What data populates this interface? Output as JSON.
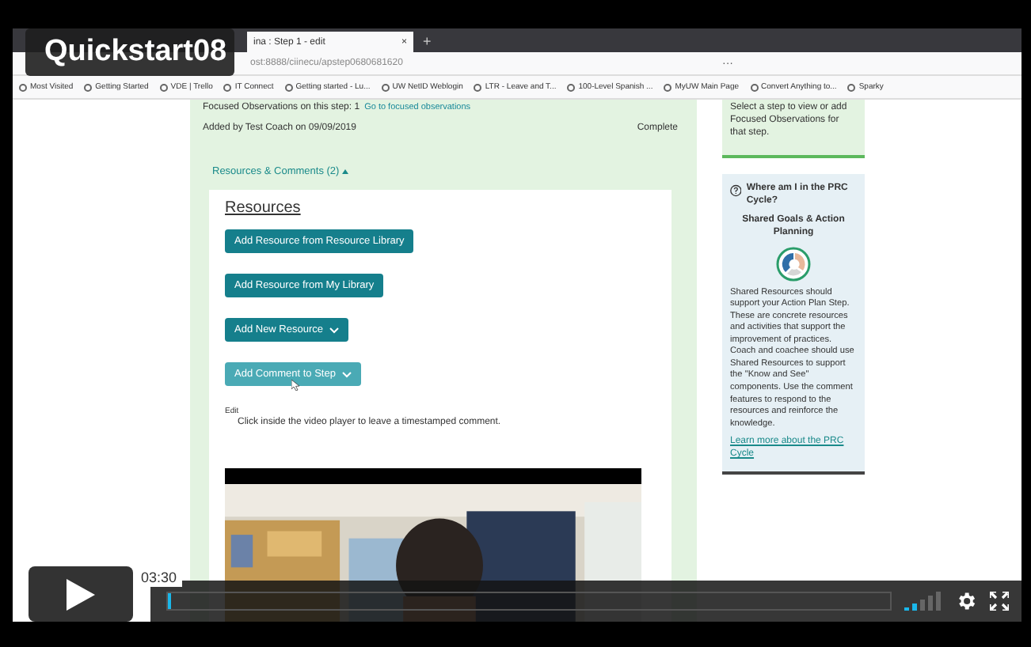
{
  "player": {
    "title": "Quickstart08",
    "time": "03:30",
    "progress": {
      "level": 0.004
    }
  },
  "browser": {
    "tab": {
      "title": "ina : Step 1 - edit",
      "close": "×"
    },
    "new_tab": "+",
    "address": "ost:8888/ciinecu/apstep0680681620",
    "address_actions": "···",
    "bookmarks": [
      "Most Visited",
      "Getting Started",
      "VDE | Trello",
      "IT Connect",
      "Getting started - Lu...",
      "UW NetID Weblogin",
      "LTR - Leave and T...",
      "100-Level Spanish ...",
      "MyUW Main Page",
      "Convert Anything to...",
      "Sparky"
    ]
  },
  "step": {
    "focused_label": "Focused Observations on this step:",
    "focused_count": "1",
    "focused_link": "Go to focused observations",
    "added_by": "Added by Test Coach on 09/09/2019",
    "status": "Complete",
    "toggle": "Resources & Comments (2)",
    "expanded": true
  },
  "resources": {
    "heading": "Resources",
    "buttons": [
      {
        "label": "Add Resource from Resource Library",
        "dropdown": false,
        "hovered": false
      },
      {
        "label": "Add Resource from My Library",
        "dropdown": false,
        "hovered": false
      },
      {
        "label": "Add New Resource",
        "dropdown": true,
        "hovered": false
      },
      {
        "label": "Add Comment to Step",
        "dropdown": true,
        "hovered": true
      }
    ],
    "edit": "Edit",
    "hint": "Click inside the video player to leave a timestamped comment."
  },
  "sidebar": {
    "select_hint": "Select a step to view or add Focused Observations for that step.",
    "where_title": "Where am I in the PRC Cycle?",
    "phase": "Shared Goals & Action Planning",
    "description": "Shared Resources should support your Action Plan Step. These are concrete resources and activities that support the improvement of practices. Coach and coachee should use Shared Resources to support the \"Know and See\" components. Use the comment features to respond to the resources and reinforce the knowledge.",
    "link": "Learn more about the PRC Cycle"
  }
}
